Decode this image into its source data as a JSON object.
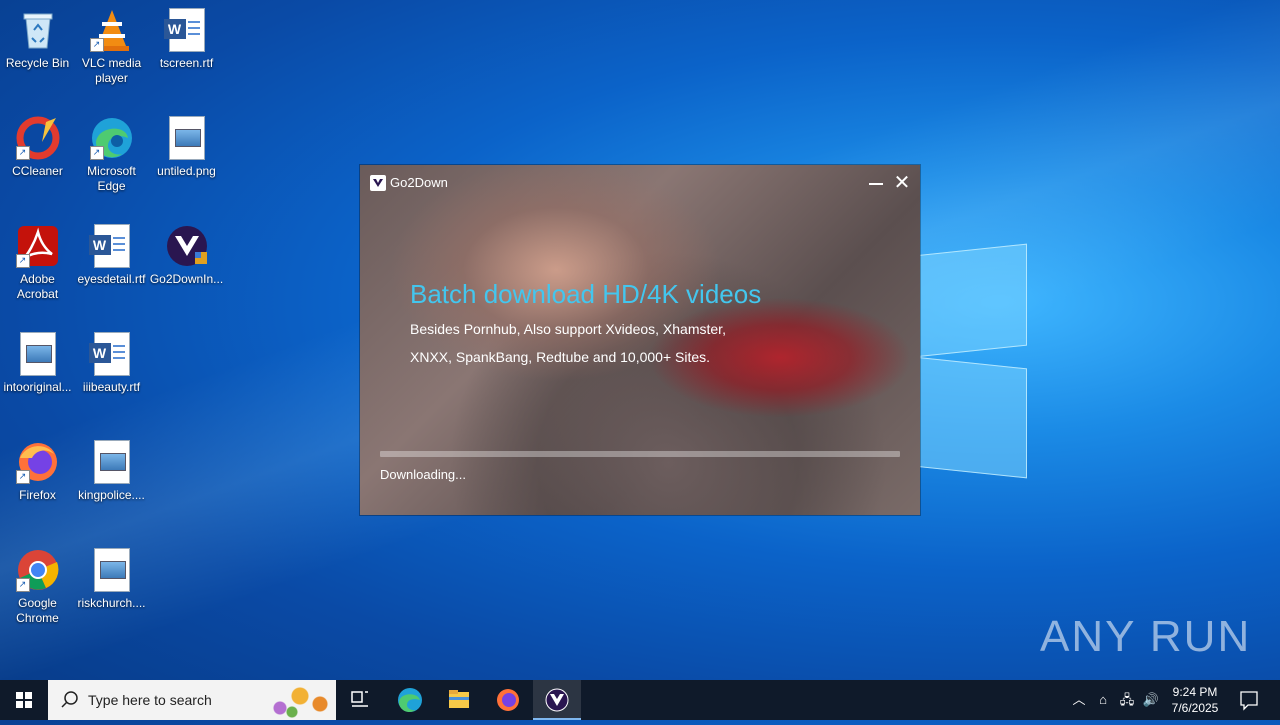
{
  "desktop": {
    "icons": [
      {
        "label": "Recycle Bin"
      },
      {
        "label": "VLC media player"
      },
      {
        "label": "tscreen.rtf"
      },
      {
        "label": "CCleaner"
      },
      {
        "label": "Microsoft Edge"
      },
      {
        "label": "untiled.png"
      },
      {
        "label": "Adobe Acrobat"
      },
      {
        "label": "eyesdetail.rtf"
      },
      {
        "label": "Go2DownIn..."
      },
      {
        "label": "intooriginal..."
      },
      {
        "label": "iiibeauty.rtf"
      },
      {
        "label": "Firefox"
      },
      {
        "label": "kingpolice...."
      },
      {
        "label": "Google Chrome"
      },
      {
        "label": "riskchurch...."
      }
    ]
  },
  "dialog": {
    "title": "Go2Down",
    "minimize_label": "—",
    "close_label": "✕",
    "headline": "Batch download HD/4K videos",
    "subline": "Besides Pornhub, Also support Xvideos, Xhamster, XNXX, SpankBang, Redtube and 10,000+ Sites.",
    "progress": 0.0,
    "status": "Downloading..."
  },
  "watermark": {
    "text": "ANY RUN"
  },
  "taskbar": {
    "search_placeholder": "Type here to search",
    "clock_time": "9:24 PM",
    "clock_date": "7/6/2025",
    "icons": [
      "windows-start-icon",
      "task-view-icon",
      "edge-icon",
      "file-explorer-icon",
      "firefox-icon",
      "go2down-icon"
    ]
  },
  "colors": {
    "headline": "#43c6ee",
    "taskbar": "#0f1a2a",
    "desktop": "#0b63c9"
  }
}
